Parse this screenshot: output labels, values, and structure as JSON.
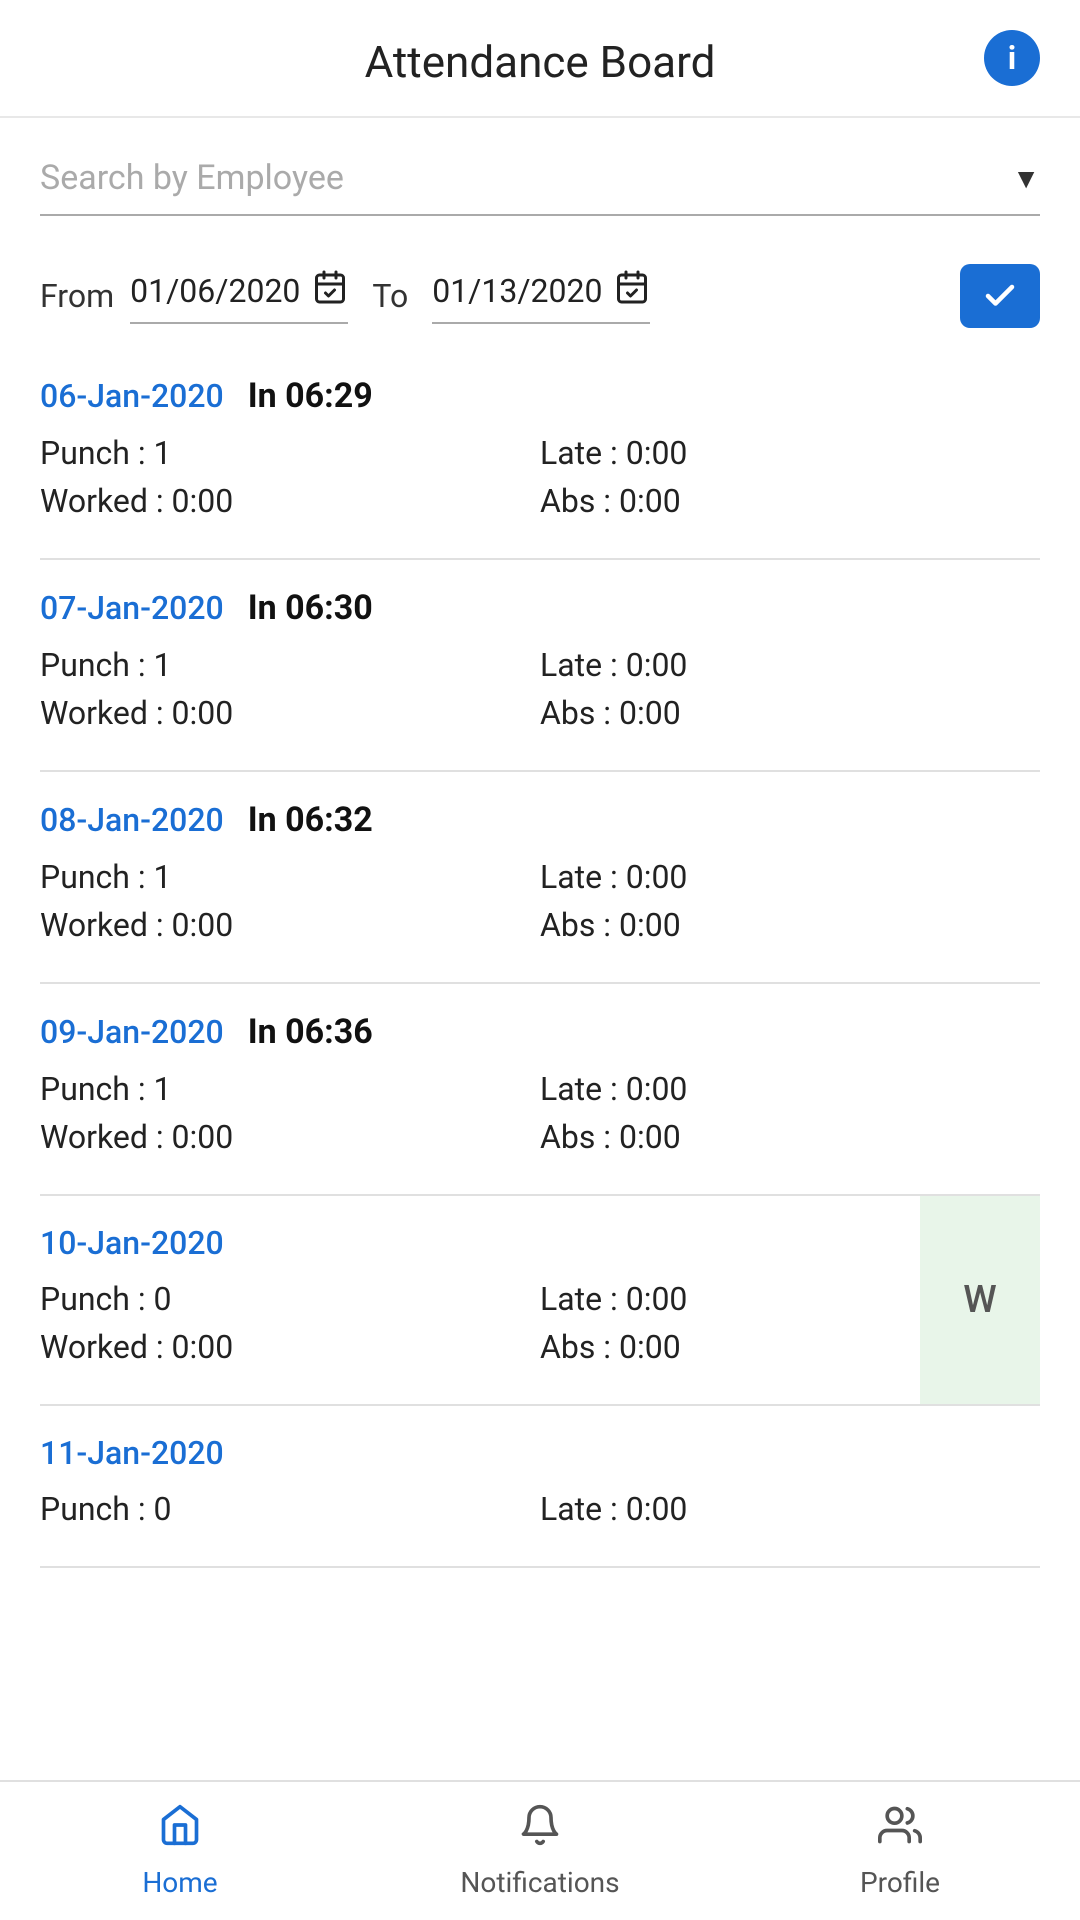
{
  "header": {
    "title": "Attendance Board",
    "info_icon_label": "i"
  },
  "search": {
    "placeholder": "Search by Employee",
    "dropdown_arrow": "▼"
  },
  "date_range": {
    "from_label": "From",
    "from_value": "01/06/2020",
    "to_label": "To",
    "to_value": "01/13/2020",
    "confirm_label": "✓"
  },
  "entries": [
    {
      "date": "06-Jan-2020",
      "in_time": "In 06:29",
      "punch": "Punch : 1",
      "late": "Late : 0:00",
      "worked": "Worked : 0:00",
      "abs": "Abs : 0:00",
      "weekend": false
    },
    {
      "date": "07-Jan-2020",
      "in_time": "In 06:30",
      "punch": "Punch : 1",
      "late": "Late : 0:00",
      "worked": "Worked : 0:00",
      "abs": "Abs : 0:00",
      "weekend": false
    },
    {
      "date": "08-Jan-2020",
      "in_time": "In 06:32",
      "punch": "Punch : 1",
      "late": "Late : 0:00",
      "worked": "Worked : 0:00",
      "abs": "Abs : 0:00",
      "weekend": false
    },
    {
      "date": "09-Jan-2020",
      "in_time": "In 06:36",
      "punch": "Punch : 1",
      "late": "Late : 0:00",
      "worked": "Worked : 0:00",
      "abs": "Abs : 0:00",
      "weekend": false
    },
    {
      "date": "10-Jan-2020",
      "in_time": "",
      "punch": "Punch : 0",
      "late": "Late : 0:00",
      "worked": "Worked : 0:00",
      "abs": "Abs : 0:00",
      "weekend": true,
      "weekend_label": "W"
    },
    {
      "date": "11-Jan-2020",
      "in_time": "",
      "punch": "Punch : 0",
      "late": "Late : 0:00",
      "worked": "",
      "abs": "",
      "weekend": false
    }
  ],
  "bottom_nav": {
    "items": [
      {
        "label": "Home",
        "icon": "home",
        "active": true
      },
      {
        "label": "Notifications",
        "icon": "bell",
        "active": false
      },
      {
        "label": "Profile",
        "icon": "profile",
        "active": false
      }
    ]
  }
}
